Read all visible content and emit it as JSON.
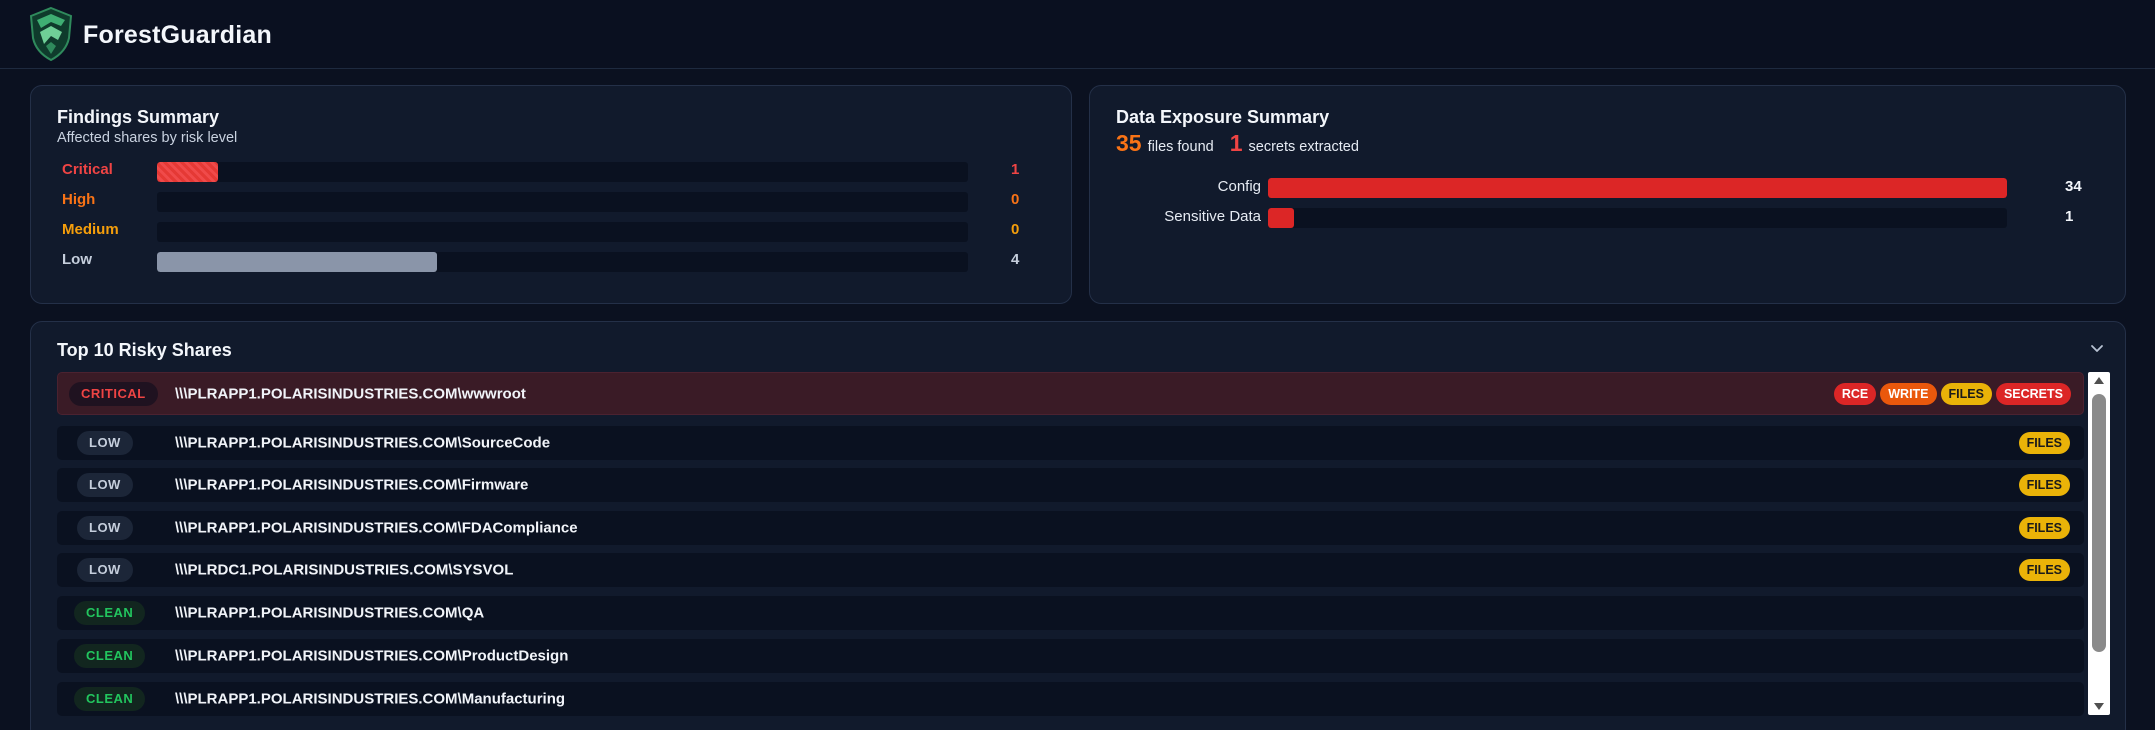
{
  "app": {
    "title": "ForestGuardian"
  },
  "colors": {
    "critical": "#ef4444",
    "high": "#f97316",
    "medium": "#f59e0b",
    "low": "#c5cedc",
    "clean": "#22c55e",
    "accent_red": "#dc2626"
  },
  "findings": {
    "title": "Findings Summary",
    "subtitle": "Affected shares by risk level",
    "levels": [
      {
        "label": "Critical",
        "count": "1",
        "fraction": 0.075
      },
      {
        "label": "High",
        "count": "0",
        "fraction": 0
      },
      {
        "label": "Medium",
        "count": "0",
        "fraction": 0
      },
      {
        "label": "Low",
        "count": "4",
        "fraction": 0.345
      }
    ]
  },
  "exposure": {
    "title": "Data Exposure Summary",
    "files_count": "35",
    "files_label": "files found",
    "secrets_count": "1",
    "secrets_label": "secrets extracted",
    "categories": [
      {
        "label": "Config",
        "count": "34",
        "fraction": 1.0
      },
      {
        "label": "Sensitive Data",
        "count": "1",
        "fraction": 0.035
      }
    ]
  },
  "shares": {
    "title": "Top 10 Risky Shares",
    "rows": [
      {
        "level": "CRITICAL",
        "path": "\\\\\\PLRAPP1.POLARISINDUSTRIES.COM\\wwwroot",
        "tags": [
          "RCE",
          "WRITE",
          "FILES",
          "SECRETS"
        ]
      },
      {
        "level": "LOW",
        "path": "\\\\\\PLRAPP1.POLARISINDUSTRIES.COM\\SourceCode",
        "tags": [
          "FILES"
        ]
      },
      {
        "level": "LOW",
        "path": "\\\\\\PLRAPP1.POLARISINDUSTRIES.COM\\Firmware",
        "tags": [
          "FILES"
        ]
      },
      {
        "level": "LOW",
        "path": "\\\\\\PLRAPP1.POLARISINDUSTRIES.COM\\FDACompliance",
        "tags": [
          "FILES"
        ]
      },
      {
        "level": "LOW",
        "path": "\\\\\\PLRDC1.POLARISINDUSTRIES.COM\\SYSVOL",
        "tags": [
          "FILES"
        ]
      },
      {
        "level": "CLEAN",
        "path": "\\\\\\PLRAPP1.POLARISINDUSTRIES.COM\\QA",
        "tags": []
      },
      {
        "level": "CLEAN",
        "path": "\\\\\\PLRAPP1.POLARISINDUSTRIES.COM\\ProductDesign",
        "tags": []
      },
      {
        "level": "CLEAN",
        "path": "\\\\\\PLRAPP1.POLARISINDUSTRIES.COM\\Manufacturing",
        "tags": []
      }
    ]
  }
}
